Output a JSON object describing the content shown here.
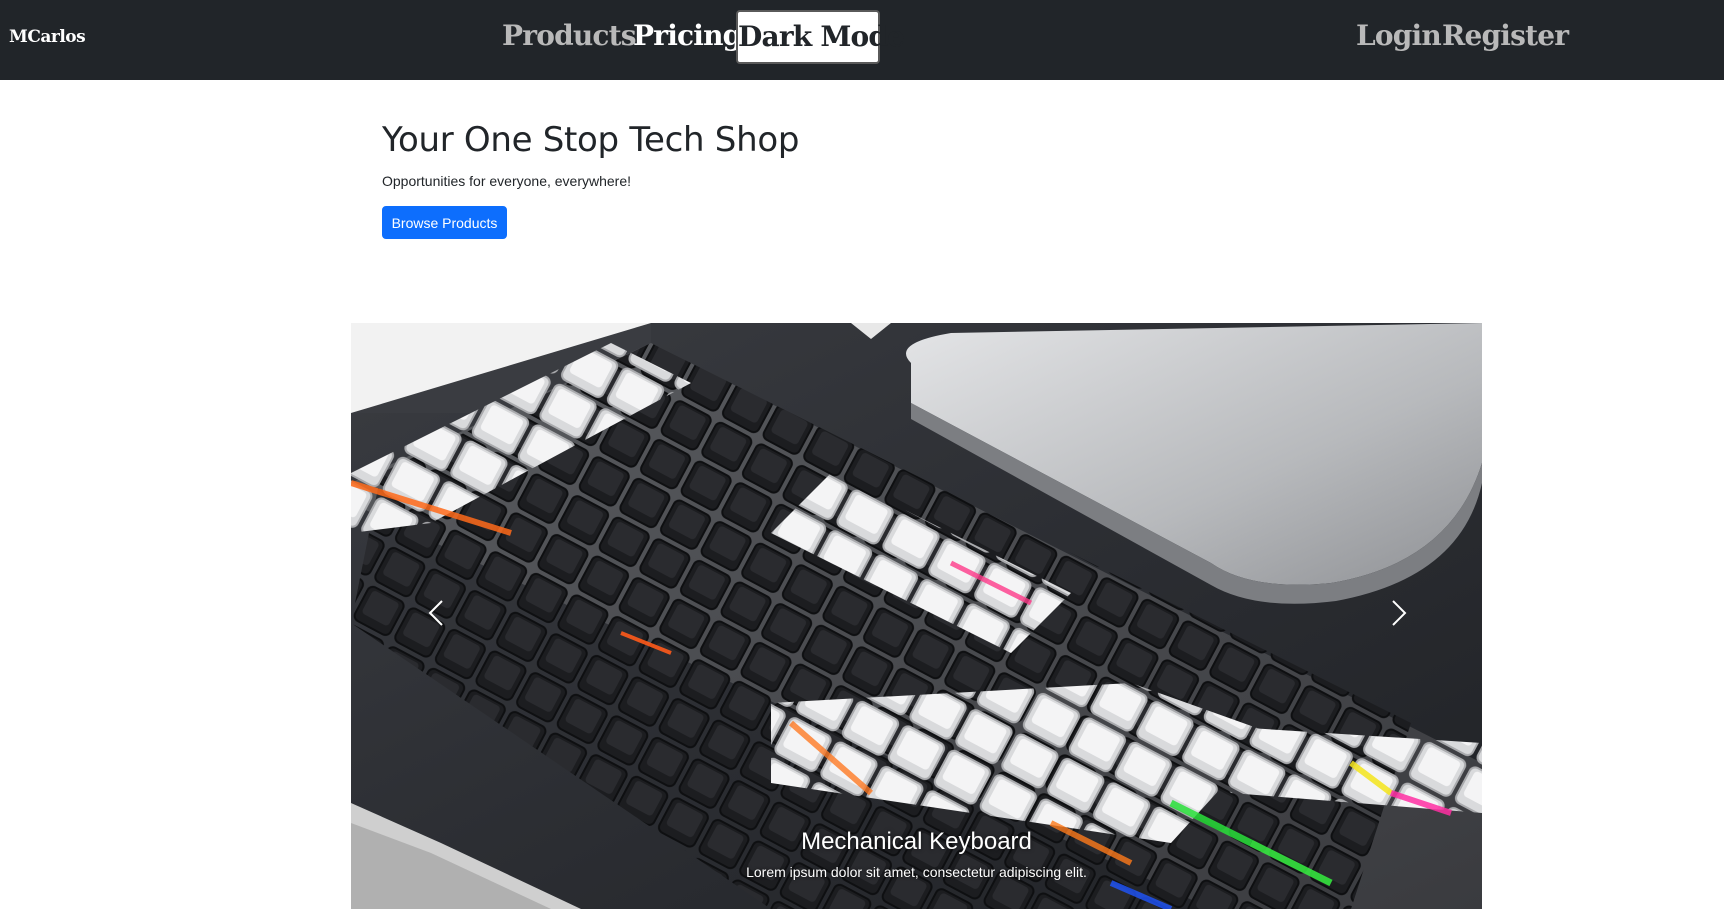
{
  "navbar": {
    "brand": "MCarlos",
    "products": "Products",
    "pricing": "Pricing",
    "dark_mode": "Dark Mode",
    "login": "Login",
    "register": "Register",
    "background_color": "#212529"
  },
  "hero": {
    "title": "Your One Stop Tech Shop",
    "subtitle": "Opportunities for everyone, everywhere!",
    "button": "Browse Products",
    "button_color": "#0d6efd"
  },
  "carousel": {
    "slide_image": "mechanical-keyboard-photo",
    "caption_title": "Mechanical Keyboard",
    "caption_text": "Lorem ipsum dolor sit amet, consectetur adipiscing elit.",
    "prev_icon": "chevron-left-icon",
    "next_icon": "chevron-right-icon"
  }
}
